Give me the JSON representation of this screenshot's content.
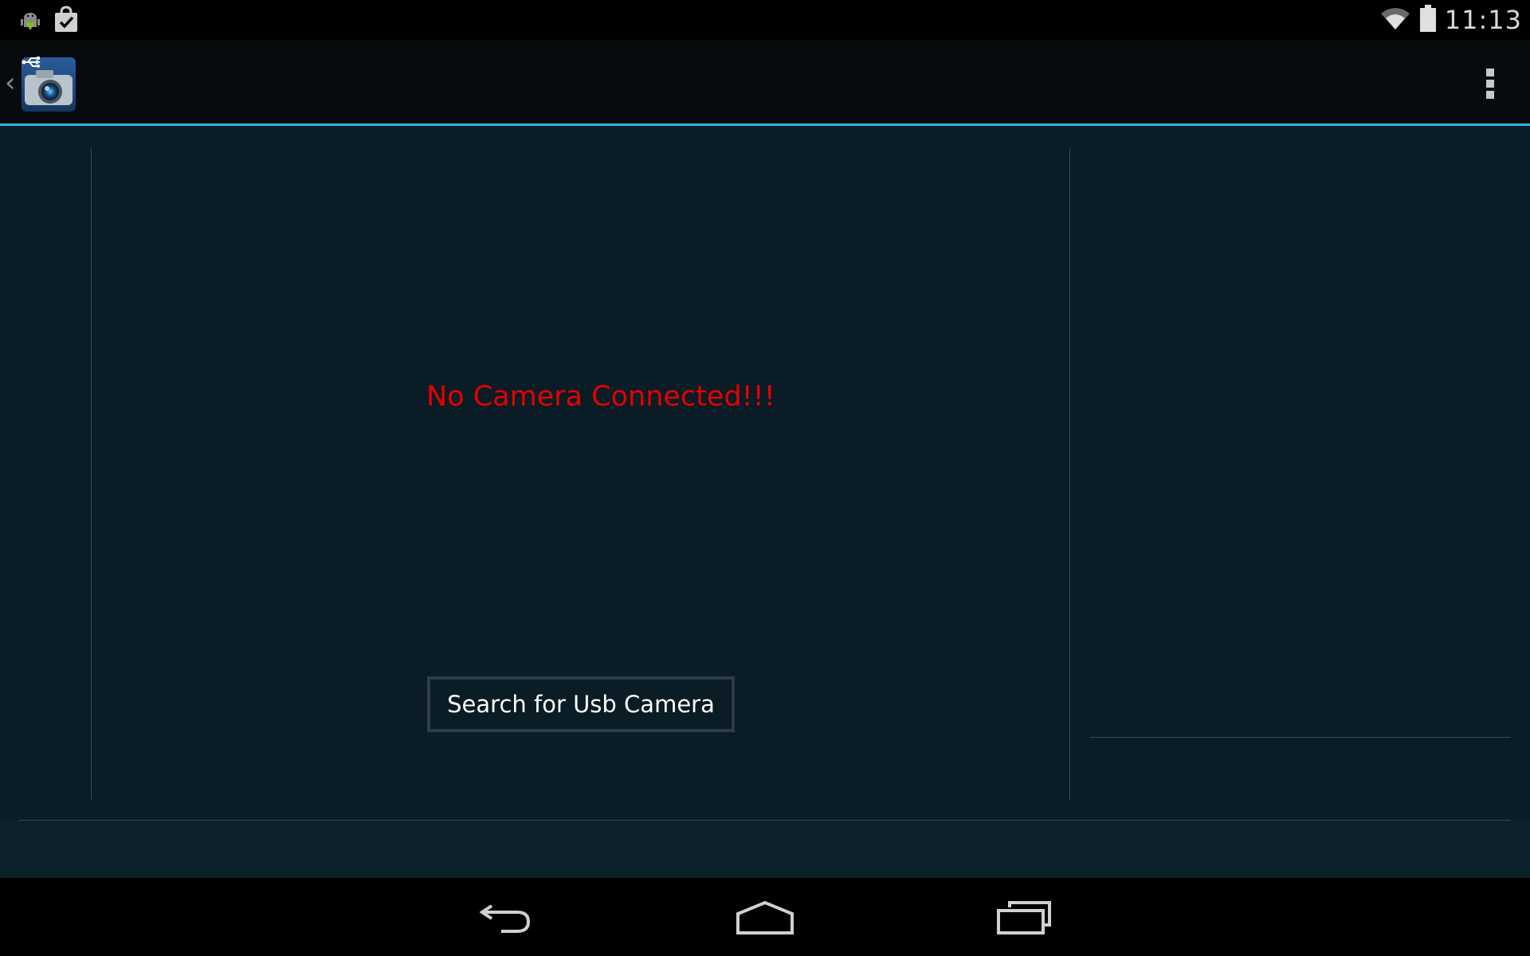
{
  "status_bar": {
    "time": "11:13",
    "left_icons": [
      "android-debug-icon",
      "shopping-bag-check-icon"
    ],
    "right_icons": [
      "wifi-icon",
      "battery-icon"
    ]
  },
  "action_bar": {
    "app_icon": "usb-camera-app-icon",
    "up_icon": "up-caret-icon",
    "overflow_icon": "overflow-menu-icon",
    "accent_color": "#33b5e5"
  },
  "main": {
    "status_message": "No Camera Connected!!!",
    "status_color": "#e50000",
    "search_button_label": "Search for Usb Camera"
  },
  "nav_bar": {
    "back_icon": "back-icon",
    "home_icon": "home-icon",
    "recents_icon": "recent-apps-icon"
  }
}
